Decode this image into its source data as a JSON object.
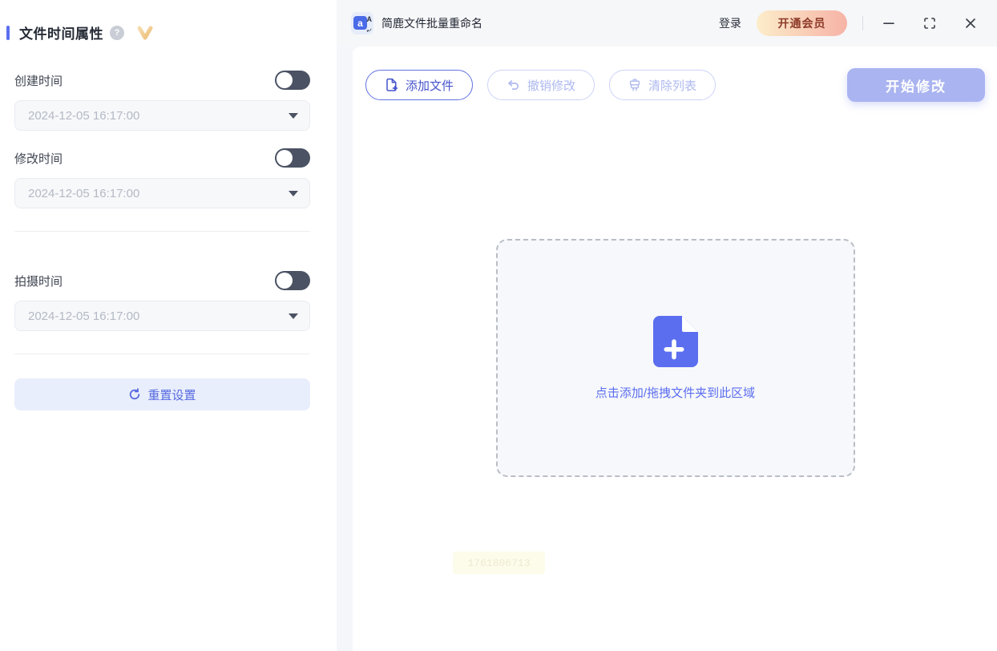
{
  "window": {
    "title": "简鹿文件批量重命名",
    "login_label": "登录",
    "vip_button_label": "开通会员"
  },
  "sidebar": {
    "title": "文件时间属性",
    "sections": [
      {
        "label": "创建时间",
        "value": "2024-12-05 16:17:00",
        "enabled": false
      },
      {
        "label": "修改时间",
        "value": "2024-12-05 16:17:00",
        "enabled": false
      },
      {
        "label": "拍摄时间",
        "value": "2024-12-05 16:17:00",
        "enabled": false
      }
    ],
    "reset_button_label": "重置设置"
  },
  "toolbar": {
    "add_files_label": "添加文件",
    "undo_label": "撤销修改",
    "clear_list_label": "清除列表",
    "start_label": "开始修改"
  },
  "dropzone": {
    "hint": "点击添加/拖拽文件夹到此区域"
  },
  "watermark": {
    "text": "1761806713"
  },
  "icons": {
    "app_logo_letter": "a",
    "app_logo_mini_letter": "A",
    "help_glyph": "?"
  },
  "colors": {
    "accent": "#5b6ef0",
    "toggle_off": "#4a5263",
    "start_button_bg": "#aab4f0",
    "vip_gradient_start": "#fcedca",
    "vip_gradient_end": "#f6b3a6",
    "vip_text": "#8c3a28",
    "reset_button_bg": "#e9eefc",
    "dropzone_bg": "#f7f8fb",
    "dropzone_border": "#b9bdc6"
  }
}
